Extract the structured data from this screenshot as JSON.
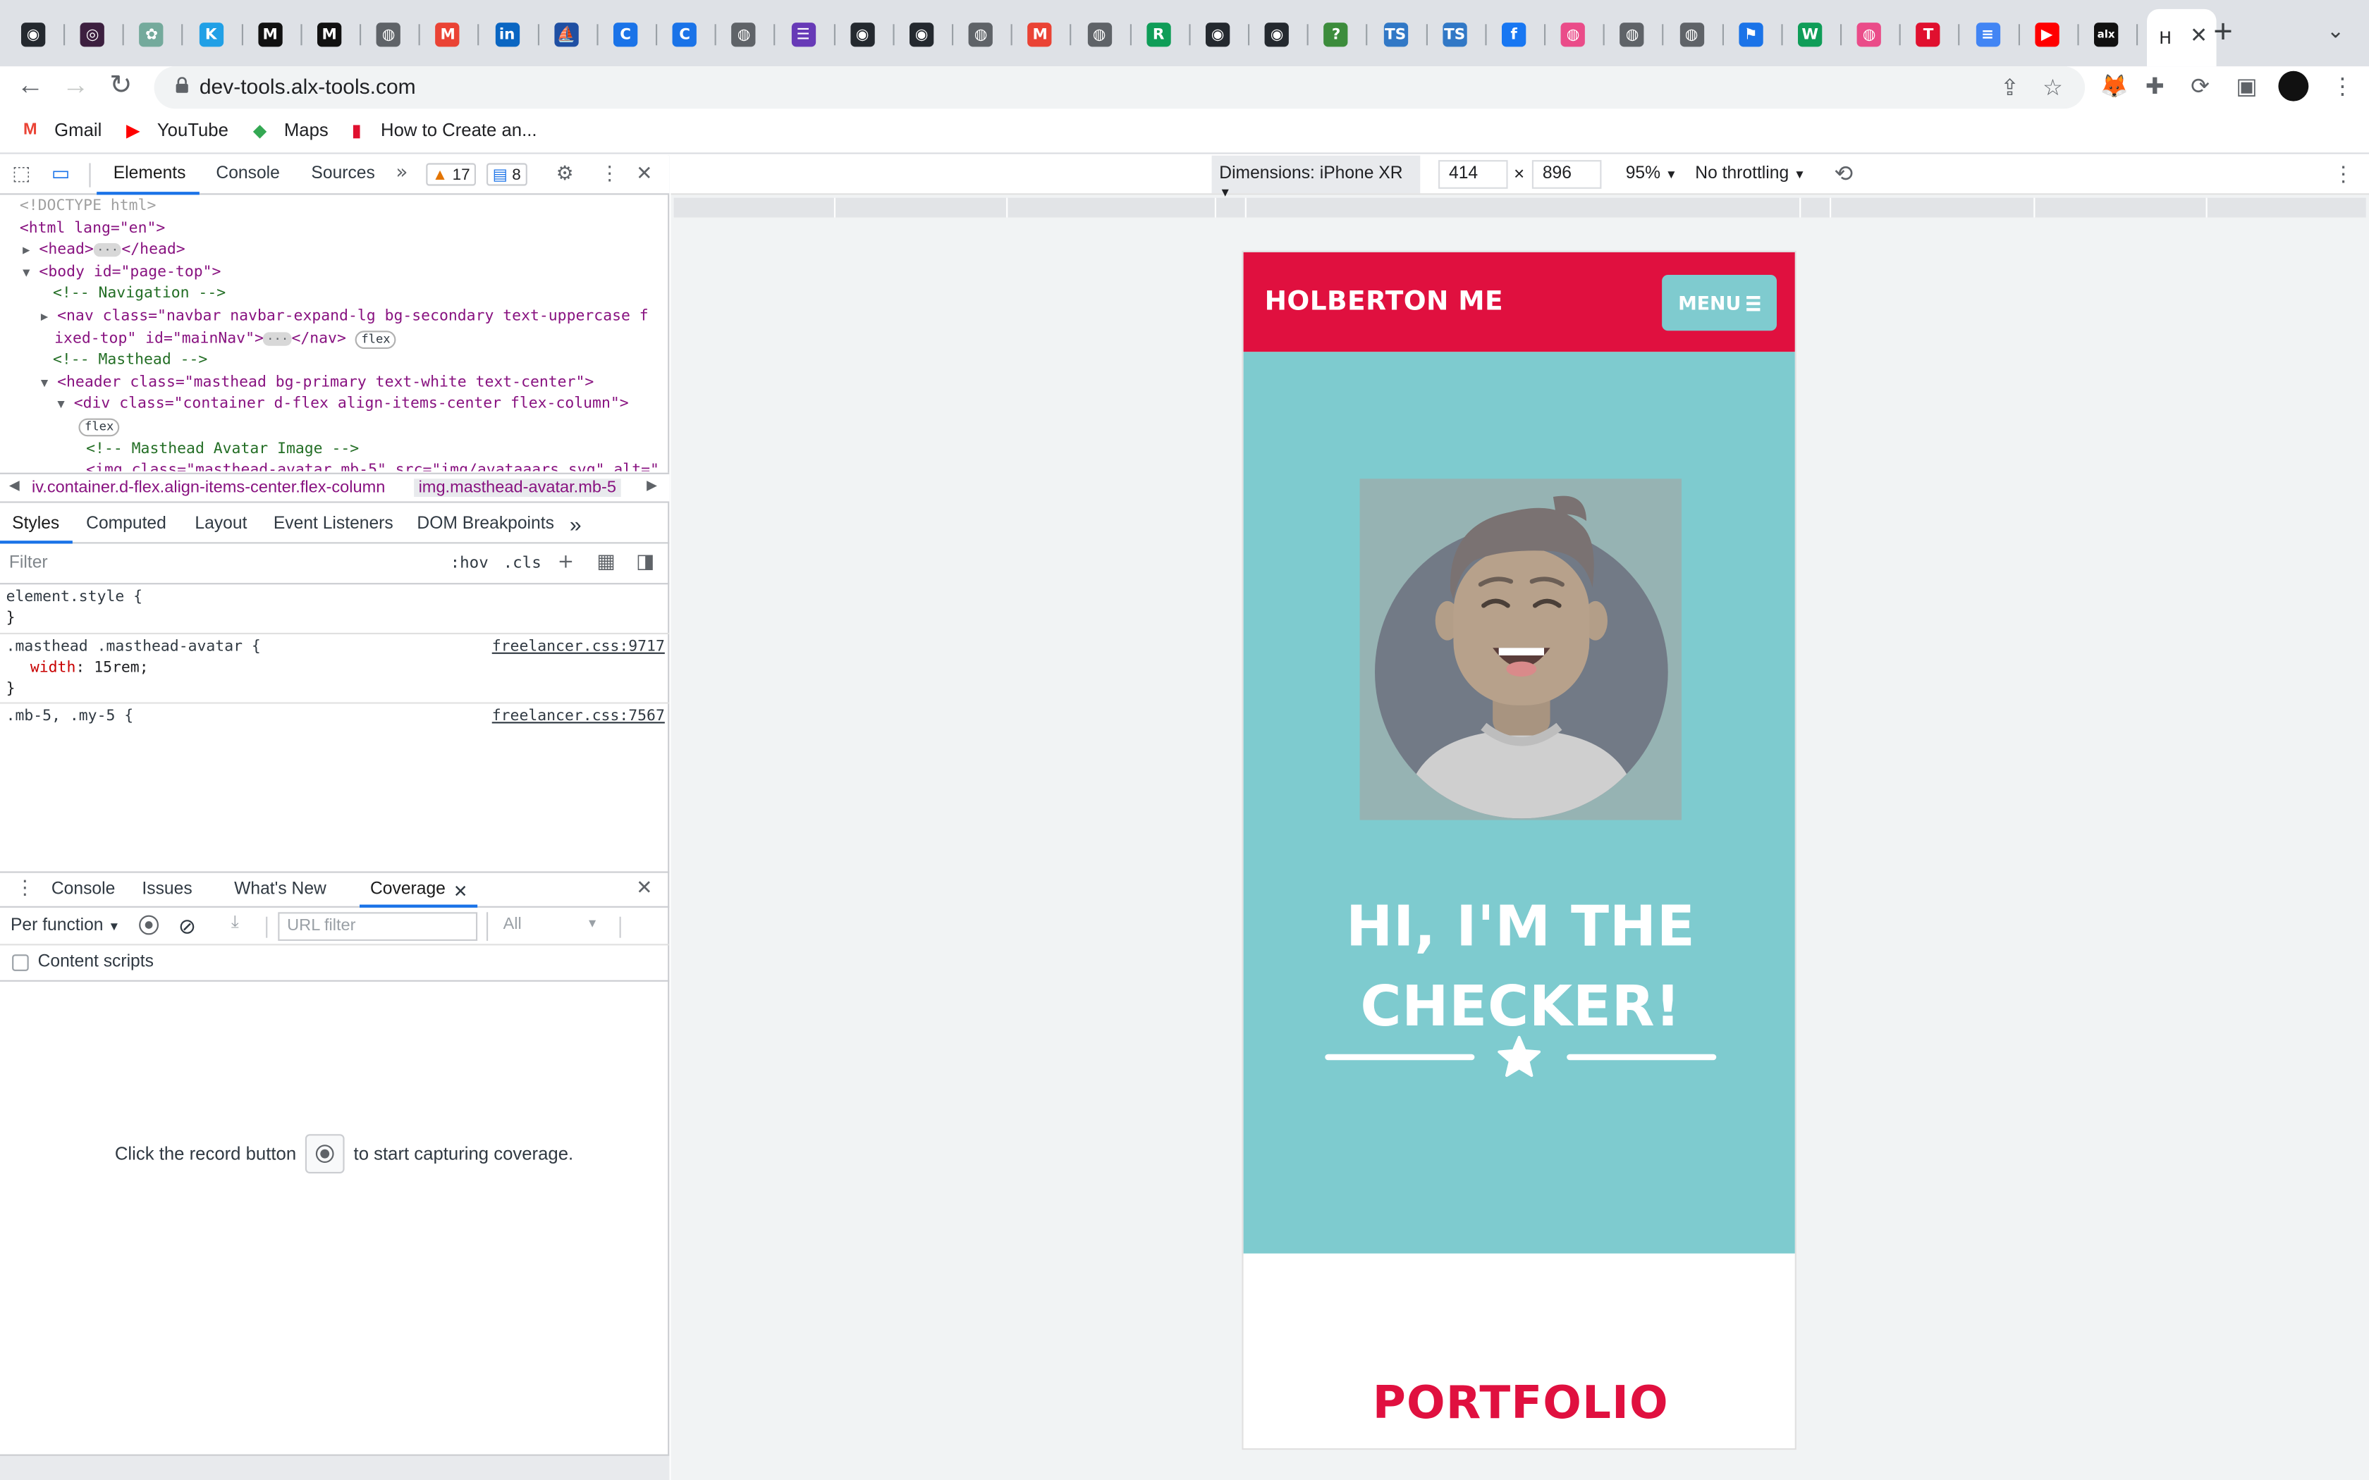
{
  "browser": {
    "tabs": [
      {
        "icon": "github-icon",
        "color": "#24292f",
        "glyph": "◉"
      },
      {
        "icon": "openai-icon",
        "color": "#3c1f3f",
        "glyph": "◎"
      },
      {
        "icon": "chatgpt-icon",
        "color": "#74aa9c",
        "glyph": "✿"
      },
      {
        "icon": "k-icon",
        "color": "#21a0e6",
        "glyph": "K"
      },
      {
        "icon": "m-icon",
        "color": "#111111",
        "glyph": "M"
      },
      {
        "icon": "m-icon",
        "color": "#111111",
        "glyph": "M"
      },
      {
        "icon": "globe-icon",
        "color": "#5f6368",
        "glyph": "◍"
      },
      {
        "icon": "gmail-icon",
        "color": "#ea4335",
        "glyph": "M"
      },
      {
        "icon": "linkedin-icon",
        "color": "#0a66c2",
        "glyph": "in"
      },
      {
        "icon": "ship-icon",
        "color": "#1f4fa3",
        "glyph": "⛵"
      },
      {
        "icon": "c-icon",
        "color": "#1a73e8",
        "glyph": "C"
      },
      {
        "icon": "c-icon",
        "color": "#1a73e8",
        "glyph": "C"
      },
      {
        "icon": "globe-icon",
        "color": "#5f6368",
        "glyph": "◍"
      },
      {
        "icon": "forms-icon",
        "color": "#673ab7",
        "glyph": "☰"
      },
      {
        "icon": "github-icon",
        "color": "#24292f",
        "glyph": "◉"
      },
      {
        "icon": "github-icon",
        "color": "#24292f",
        "glyph": "◉"
      },
      {
        "icon": "globe-icon",
        "color": "#5f6368",
        "glyph": "◍"
      },
      {
        "icon": "gmail-icon",
        "color": "#ea4335",
        "glyph": "M"
      },
      {
        "icon": "globe-icon",
        "color": "#5f6368",
        "glyph": "◍"
      },
      {
        "icon": "r-icon",
        "color": "#0f9d58",
        "glyph": "R"
      },
      {
        "icon": "github-icon",
        "color": "#24292f",
        "glyph": "◉"
      },
      {
        "icon": "github-icon",
        "color": "#24292f",
        "glyph": "◉"
      },
      {
        "icon": "help-icon",
        "color": "#3c8c3c",
        "glyph": "?"
      },
      {
        "icon": "ts-icon",
        "color": "#3178c6",
        "glyph": "TS"
      },
      {
        "icon": "ts-icon",
        "color": "#3178c6",
        "glyph": "TS"
      },
      {
        "icon": "facebook-icon",
        "color": "#1877f2",
        "glyph": "f"
      },
      {
        "icon": "dribbble-icon",
        "color": "#ea4c89",
        "glyph": "◍"
      },
      {
        "icon": "globe-icon",
        "color": "#5f6368",
        "glyph": "◍"
      },
      {
        "icon": "globe-icon",
        "color": "#5f6368",
        "glyph": "◍"
      },
      {
        "icon": "flag-icon",
        "color": "#1a73e8",
        "glyph": "⚑"
      },
      {
        "icon": "w-icon",
        "color": "#0f9d58",
        "glyph": "W"
      },
      {
        "icon": "dribbble-icon",
        "color": "#ea4c89",
        "glyph": "◍"
      },
      {
        "icon": "t-icon",
        "color": "#e0102f",
        "glyph": "T"
      },
      {
        "icon": "docs-icon",
        "color": "#4285f4",
        "glyph": "≡"
      },
      {
        "icon": "youtube-icon",
        "color": "#ff0000",
        "glyph": "▶"
      },
      {
        "icon": "alx-icon",
        "color": "#111111",
        "glyph": "alx"
      }
    ],
    "active_tab": {
      "label": "H",
      "icon": "holberton-icon"
    },
    "url": "dev-tools.alx-tools.com",
    "bookmarks": [
      {
        "label": "Gmail",
        "icon": "gmail-icon",
        "color": "#ea4335",
        "glyph": "M"
      },
      {
        "label": "YouTube",
        "icon": "youtube-icon",
        "color": "#ff0000",
        "glyph": "▶"
      },
      {
        "label": "Maps",
        "icon": "maps-icon",
        "color": "#34a853",
        "glyph": "◆"
      },
      {
        "label": "How to Create an...",
        "icon": "bookmark-site-icon",
        "color": "#e0102f",
        "glyph": "▮"
      }
    ]
  },
  "devtools": {
    "tabs": [
      "Elements",
      "Console",
      "Sources"
    ],
    "warnings": "17",
    "messages": "8",
    "dom": {
      "doctype": "<!DOCTYPE html>",
      "html_open": "<html lang=\"en\">",
      "head": "<head>",
      "head_close": "</head>",
      "body": "<body id=\"page-top\">",
      "comment_nav": "<!-- Navigation -->",
      "nav_line1": "<nav class=\"navbar navbar-expand-lg bg-secondary text-uppercase f",
      "nav_line2": "ixed-top\" id=\"mainNav\">",
      "nav_close": "</nav>",
      "flex": "flex",
      "comment_masthead": "<!-- Masthead -->",
      "header": "<header class=\"masthead bg-primary text-white text-center\">",
      "div": "<div class=\"container d-flex align-items-center flex-column\">",
      "comment_avatar": "<!-- Masthead Avatar Image -->",
      "img_partial": "<img class=\"masthead-avatar mb-5\" src=\"img/avataaars.svg\" alt=\""
    },
    "breadcrumbs": [
      "iv.container.d-flex.align-items-center.flex-column",
      "img.masthead-avatar.mb-5"
    ],
    "sub_tabs": [
      "Styles",
      "Computed",
      "Layout",
      "Event Listeners",
      "DOM Breakpoints"
    ],
    "filter_placeholder": "Filter",
    "hov": ":hov",
    "cls": ".cls",
    "styles": {
      "element_style": "element.style {",
      "close": "}",
      "rule_selector": ".masthead .masthead-avatar {",
      "rule_source": "freelancer.css:9717",
      "prop_name": "width",
      "prop_value": "15rem;",
      "next_selector": ".mb-5, .my-5 {",
      "next_source": "freelancer.css:7567"
    },
    "drawer_tabs": [
      "Console",
      "Issues",
      "What's New",
      "Coverage"
    ],
    "coverage": {
      "mode": "Per function",
      "url_filter_placeholder": "URL filter",
      "type_filter": "All",
      "content_scripts": "Content scripts",
      "msg_before": "Click the record button",
      "msg_after": "to start capturing coverage."
    }
  },
  "device_toolbar": {
    "dimensions": "Dimensions: iPhone XR",
    "width": "414",
    "height": "896",
    "zoom": "95%",
    "throttling": "No throttling"
  },
  "site": {
    "brand": "HOLBERTON ME",
    "menu": "MENU",
    "hero_line1": "HI, I'M THE",
    "hero_line2": "CHECKER!",
    "portfolio": "PORTFOLIO",
    "colors": {
      "primary": "#7ecbcf",
      "secondary": "#e0103f"
    }
  }
}
